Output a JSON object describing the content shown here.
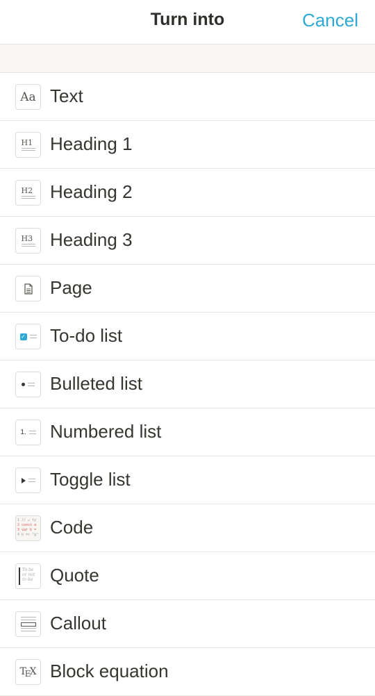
{
  "header": {
    "title": "Turn into",
    "cancel_label": "Cancel"
  },
  "items": [
    {
      "label": "Text",
      "icon": "text-icon"
    },
    {
      "label": "Heading 1",
      "icon": "heading1-icon"
    },
    {
      "label": "Heading 2",
      "icon": "heading2-icon"
    },
    {
      "label": "Heading 3",
      "icon": "heading3-icon"
    },
    {
      "label": "Page",
      "icon": "page-icon"
    },
    {
      "label": "To-do list",
      "icon": "todo-list-icon"
    },
    {
      "label": "Bulleted list",
      "icon": "bulleted-list-icon"
    },
    {
      "label": "Numbered list",
      "icon": "numbered-list-icon"
    },
    {
      "label": "Toggle list",
      "icon": "toggle-list-icon"
    },
    {
      "label": "Code",
      "icon": "code-icon"
    },
    {
      "label": "Quote",
      "icon": "quote-icon"
    },
    {
      "label": "Callout",
      "icon": "callout-icon"
    },
    {
      "label": "Block equation",
      "icon": "block-equation-icon"
    }
  ],
  "icon_glyphs": {
    "text": "Aa",
    "h1": "H1",
    "h2": "H2",
    "h3": "H3",
    "numbered": "1.",
    "code_lines": [
      "1 // ↵ ty",
      "2 const a",
      "3 var b =",
      "4 b => \"g\""
    ],
    "quote_text": [
      "To be",
      "or not",
      "to be"
    ],
    "tex": [
      "T",
      "E",
      "X"
    ]
  },
  "colors": {
    "accent": "#2ea8d5",
    "text": "#37352f",
    "divider": "#e6e5e1",
    "band": "#f7f6f3"
  }
}
